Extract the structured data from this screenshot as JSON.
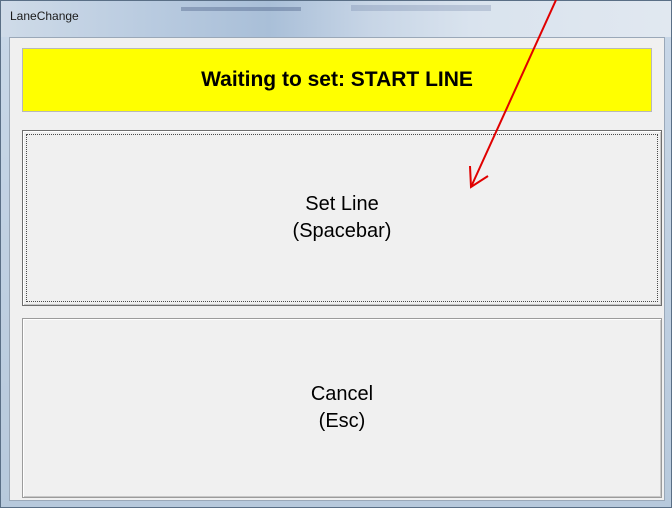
{
  "window": {
    "title": "LaneChange"
  },
  "banner": {
    "text": "Waiting to set: START LINE"
  },
  "buttons": {
    "set_line": {
      "line1": "Set Line",
      "line2": "(Spacebar)"
    },
    "cancel": {
      "line1": "Cancel",
      "line2": "(Esc)"
    }
  },
  "annotation": {
    "arrow_color": "#e00000"
  },
  "colors": {
    "banner_bg": "#ffff00",
    "button_bg": "#f0f0f0"
  }
}
